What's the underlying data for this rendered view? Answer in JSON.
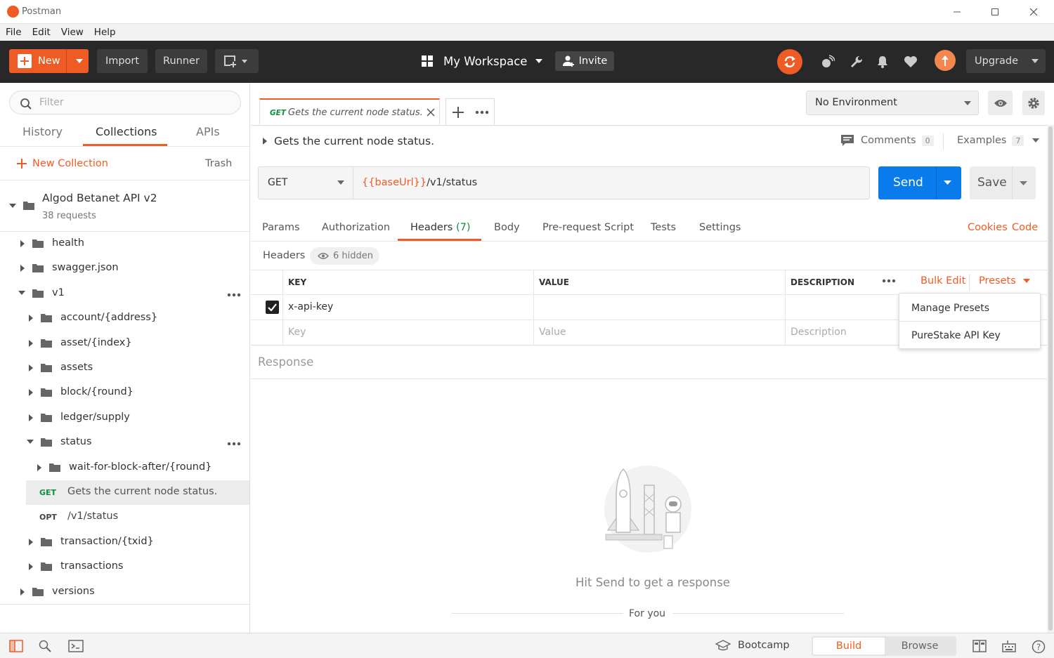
{
  "window": {
    "title": "Postman"
  },
  "menu": [
    "File",
    "Edit",
    "View",
    "Help"
  ],
  "header": {
    "new_label": "New",
    "import_label": "Import",
    "runner_label": "Runner",
    "workspace_label": "My Workspace",
    "invite_label": "Invite",
    "upgrade_label": "Upgrade"
  },
  "sidebar": {
    "filter_placeholder": "Filter",
    "tabs": [
      "History",
      "Collections",
      "APIs"
    ],
    "active_tab": "Collections",
    "new_collection_label": "New Collection",
    "trash_label": "Trash",
    "collection": {
      "name": "Algod Betanet API v2",
      "count": "38 requests"
    },
    "tree": [
      {
        "label": "health",
        "level": 1,
        "type": "folder",
        "expanded": false
      },
      {
        "label": "swagger.json",
        "level": 1,
        "type": "folder",
        "expanded": false
      },
      {
        "label": "v1",
        "level": 1,
        "type": "folder",
        "expanded": true,
        "menu": true
      },
      {
        "label": "account/{address}",
        "level": 2,
        "type": "folder",
        "expanded": false
      },
      {
        "label": "asset/{index}",
        "level": 2,
        "type": "folder",
        "expanded": false
      },
      {
        "label": "assets",
        "level": 2,
        "type": "folder",
        "expanded": false
      },
      {
        "label": "block/{round}",
        "level": 2,
        "type": "folder",
        "expanded": false
      },
      {
        "label": "ledger/supply",
        "level": 2,
        "type": "folder",
        "expanded": false
      },
      {
        "label": "status",
        "level": 2,
        "type": "folder",
        "expanded": true,
        "menu": true
      },
      {
        "label": "wait-for-block-after/{round}",
        "level": 3,
        "type": "folder",
        "expanded": false
      },
      {
        "label": "Gets the current node status.",
        "level": 3,
        "type": "request",
        "method": "GET",
        "selected": true
      },
      {
        "label": "/v1/status",
        "level": 3,
        "type": "request",
        "method": "OPT"
      },
      {
        "label": "transaction/{txid}",
        "level": 2,
        "type": "folder",
        "expanded": false
      },
      {
        "label": "transactions",
        "level": 2,
        "type": "folder",
        "expanded": false
      },
      {
        "label": "versions",
        "level": 1,
        "type": "folder",
        "expanded": false
      }
    ]
  },
  "tab": {
    "method": "GET",
    "title": "Gets the current node status."
  },
  "environment": {
    "selected": "No Environment"
  },
  "request": {
    "name": "Gets the current node status.",
    "comments_label": "Comments",
    "comments_count": "0",
    "examples_label": "Examples",
    "examples_count": "7",
    "method": "GET",
    "url_var": "{{baseUrl}}",
    "url_path": "/v1/status",
    "send_label": "Send",
    "save_label": "Save"
  },
  "request_tabs": {
    "params": "Params",
    "authorization": "Authorization",
    "headers": "Headers",
    "headers_count": "(7)",
    "body": "Body",
    "prerequest": "Pre-request Script",
    "tests": "Tests",
    "settings": "Settings",
    "cookies": "Cookies",
    "code": "Code"
  },
  "headers": {
    "section_label": "Headers",
    "hidden_label": "6 hidden",
    "col_key": "KEY",
    "col_value": "VALUE",
    "col_desc": "DESCRIPTION",
    "bulk_edit": "Bulk Edit",
    "presets": "Presets",
    "row": {
      "key": "x-api-key",
      "value": "",
      "checked": true
    },
    "placeholder_key": "Key",
    "placeholder_value": "Value",
    "placeholder_desc": "Description"
  },
  "presets_menu": [
    "Manage Presets",
    "PureStake API Key"
  ],
  "response": {
    "label": "Response",
    "empty_text": "Hit Send to get a response",
    "for_you": "For you"
  },
  "footer": {
    "bootcamp": "Bootcamp",
    "build": "Build",
    "browse": "Browse"
  },
  "colors": {
    "accent": "#ef5b25",
    "send_blue": "#097bed",
    "header_bg": "#282828",
    "get_green": "#0f8f3f"
  }
}
